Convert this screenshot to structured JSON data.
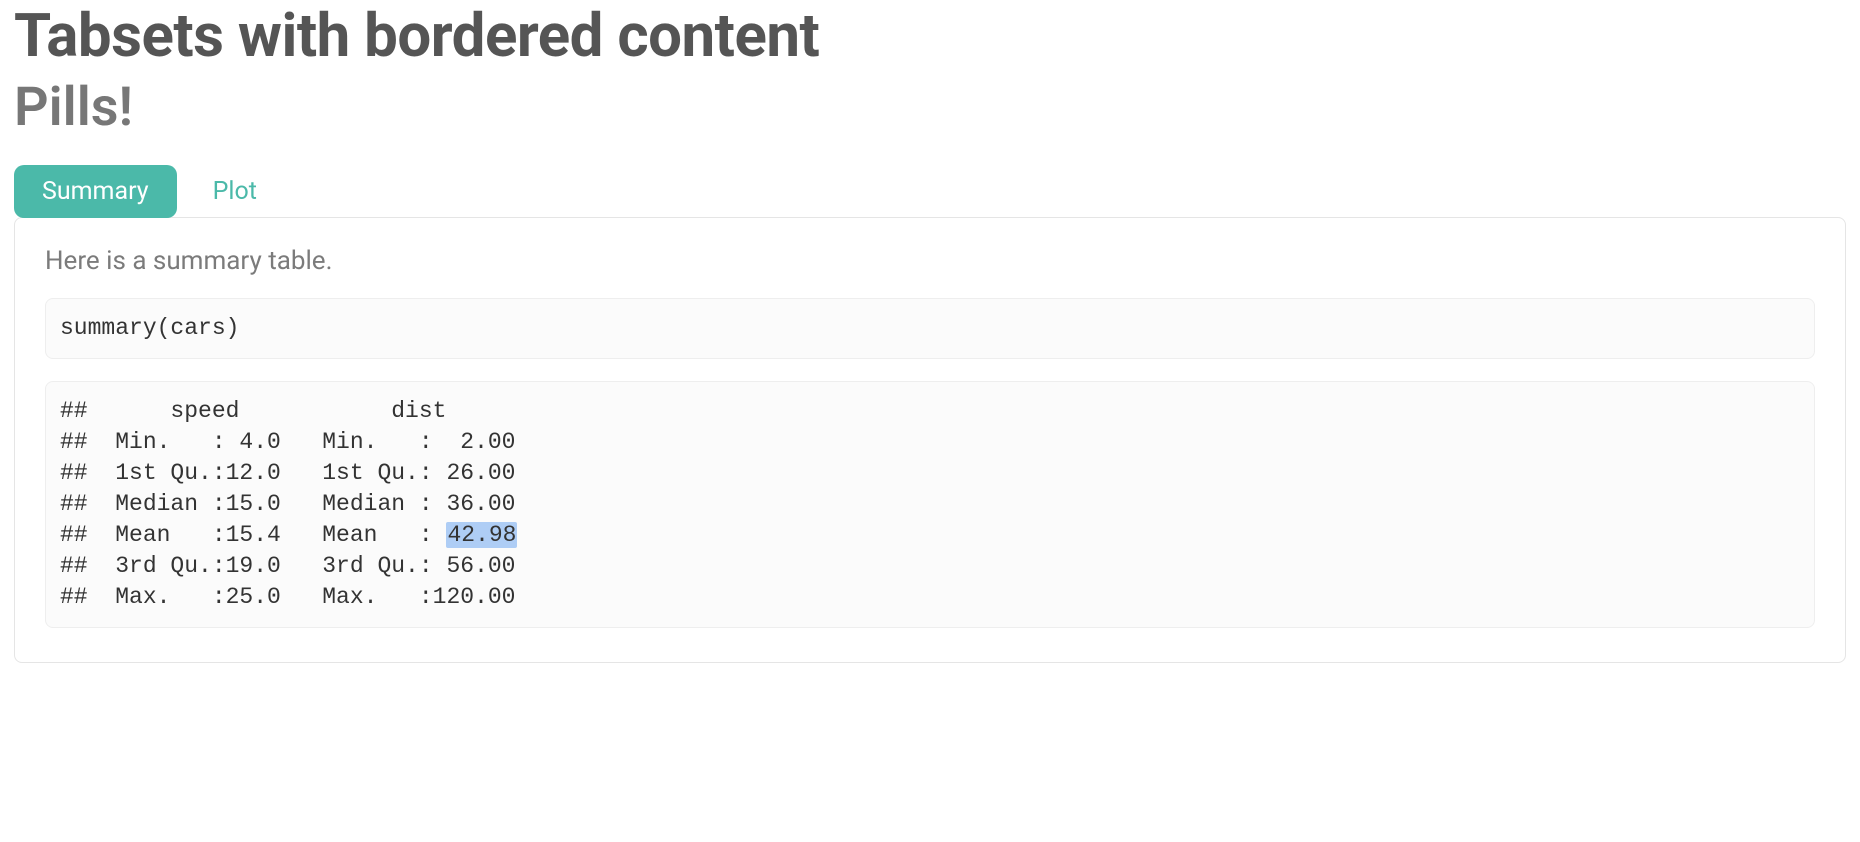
{
  "page": {
    "title": "Tabsets with bordered content",
    "subtitle": "Pills!"
  },
  "tabs": [
    {
      "label": "Summary",
      "active": true
    },
    {
      "label": "Plot",
      "active": false
    }
  ],
  "content": {
    "intro": "Here is a summary table.",
    "code": "summary(cars)",
    "output_lines": [
      "##      speed           dist       ",
      "##  Min.   : 4.0   Min.   :  2.00  ",
      "##  1st Qu.:12.0   1st Qu.: 26.00  ",
      "##  Median :15.0   Median : 36.00  ",
      "##  Mean   :15.4   Mean   : 42.98  ",
      "##  3rd Qu.:19.0   3rd Qu.: 56.00  ",
      "##  Max.   :25.0   Max.   :120.00"
    ],
    "highlight": {
      "line_index": 4,
      "text": "42.98"
    }
  }
}
